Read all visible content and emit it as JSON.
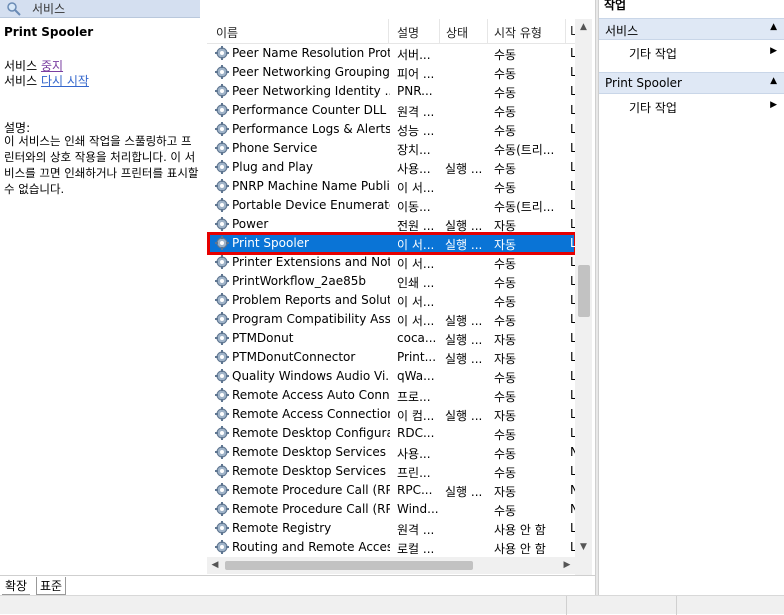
{
  "header": {
    "title": "서비스"
  },
  "detail": {
    "service_name": "Print Spooler",
    "prefix": "서비스",
    "stop_link": "중지",
    "restart_link": "다시 시작",
    "desc_label": "설명:",
    "description": "이 서비스는 인쇄 작업을 스풀링하고 프린터와의 상호 작용을 처리합니다. 이 서비스를 끄면 인쇄하거나 프린터를 표시할 수 없습니다."
  },
  "columns": {
    "name": "이름",
    "desc": "설명",
    "status": "상태",
    "startup": "시작 유형",
    "logon": "L"
  },
  "rows": [
    {
      "name": "Peer Name Resolution Prot...",
      "desc": "서버...",
      "status": "",
      "startup": "수동",
      "logon": "L"
    },
    {
      "name": "Peer Networking Grouping",
      "desc": "피어 ...",
      "status": "",
      "startup": "수동",
      "logon": "L"
    },
    {
      "name": "Peer Networking Identity ...",
      "desc": "PNR...",
      "status": "",
      "startup": "수동",
      "logon": "L"
    },
    {
      "name": "Performance Counter DLL ...",
      "desc": "원격 ...",
      "status": "",
      "startup": "수동",
      "logon": "L"
    },
    {
      "name": "Performance Logs & Alerts",
      "desc": "성능 ...",
      "status": "",
      "startup": "수동",
      "logon": "L"
    },
    {
      "name": "Phone Service",
      "desc": "장치...",
      "status": "",
      "startup": "수동(트리...",
      "logon": "L"
    },
    {
      "name": "Plug and Play",
      "desc": "사용...",
      "status": "실행 ...",
      "startup": "수동",
      "logon": "L"
    },
    {
      "name": "PNRP Machine Name Publi...",
      "desc": "이 서...",
      "status": "",
      "startup": "수동",
      "logon": "L"
    },
    {
      "name": "Portable Device Enumerato...",
      "desc": "이동...",
      "status": "",
      "startup": "수동(트리...",
      "logon": "L"
    },
    {
      "name": "Power",
      "desc": "전원 ...",
      "status": "실행 ...",
      "startup": "자동",
      "logon": "L"
    },
    {
      "name": "Print Spooler",
      "desc": "이 서...",
      "status": "실행 ...",
      "startup": "자동",
      "logon": "L"
    },
    {
      "name": "Printer Extensions and Noti...",
      "desc": "이 서...",
      "status": "",
      "startup": "수동",
      "logon": "L"
    },
    {
      "name": "PrintWorkflow_2ae85b",
      "desc": "인쇄 ...",
      "status": "",
      "startup": "수동",
      "logon": "L"
    },
    {
      "name": "Problem Reports and Solut...",
      "desc": "이 서...",
      "status": "",
      "startup": "수동",
      "logon": "L"
    },
    {
      "name": "Program Compatibility Assi...",
      "desc": "이 서...",
      "status": "실행 ...",
      "startup": "수동",
      "logon": "L"
    },
    {
      "name": "PTMDonut",
      "desc": "coca...",
      "status": "실행 ...",
      "startup": "자동",
      "logon": "L"
    },
    {
      "name": "PTMDonutConnector",
      "desc": "Print...",
      "status": "실행 ...",
      "startup": "자동",
      "logon": "L"
    },
    {
      "name": "Quality Windows Audio Vi...",
      "desc": "qWa...",
      "status": "",
      "startup": "수동",
      "logon": "L"
    },
    {
      "name": "Remote Access Auto Conn...",
      "desc": "프로...",
      "status": "",
      "startup": "수동",
      "logon": "L"
    },
    {
      "name": "Remote Access Connection...",
      "desc": "이 컴...",
      "status": "실행 ...",
      "startup": "자동",
      "logon": "L"
    },
    {
      "name": "Remote Desktop Configura...",
      "desc": "RDC...",
      "status": "",
      "startup": "수동",
      "logon": "L"
    },
    {
      "name": "Remote Desktop Services",
      "desc": "사용...",
      "status": "",
      "startup": "수동",
      "logon": "N"
    },
    {
      "name": "Remote Desktop Services ...",
      "desc": "프린...",
      "status": "",
      "startup": "수동",
      "logon": "L"
    },
    {
      "name": "Remote Procedure Call (RP...",
      "desc": "RPC...",
      "status": "실행 ...",
      "startup": "자동",
      "logon": "N"
    },
    {
      "name": "Remote Procedure Call (RP...",
      "desc": "Wind...",
      "status": "",
      "startup": "수동",
      "logon": "N"
    },
    {
      "name": "Remote Registry",
      "desc": "원격 ...",
      "status": "",
      "startup": "사용 안 함",
      "logon": "L"
    },
    {
      "name": "Routing and Remote Access",
      "desc": "로컬 ...",
      "status": "",
      "startup": "사용 안 함",
      "logon": "L"
    }
  ],
  "selected_index": 10,
  "tabs": {
    "expand": "확장",
    "standard": "표준"
  },
  "actions": {
    "title": "작업",
    "group1": "서비스",
    "group1_item": "기타 작업",
    "group2": "Print Spooler",
    "group2_item": "기타 작업"
  },
  "colors": {
    "selection": "#0a74d6",
    "highlight_border": "#e60000",
    "group_bg": "#dfe8f5"
  }
}
